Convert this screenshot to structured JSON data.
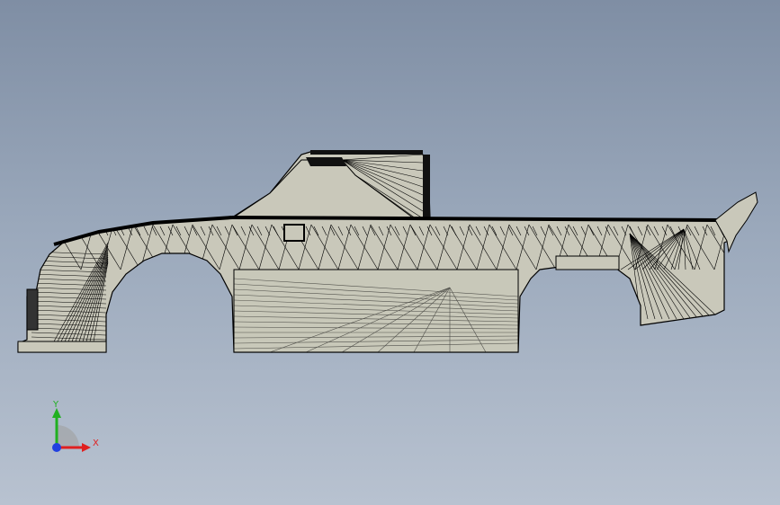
{
  "viewport": {
    "background_top": "#7f8ea4",
    "background_bottom": "#b8c2d0",
    "model": {
      "fill_color": "#c9c8ba",
      "edge_color": "#000000",
      "display_mode": "shaded-with-edges"
    }
  },
  "triad": {
    "x_label": "X",
    "y_label": "Y",
    "x_color": "#e02020",
    "y_color": "#20b020",
    "z_color": "#2040e0"
  }
}
